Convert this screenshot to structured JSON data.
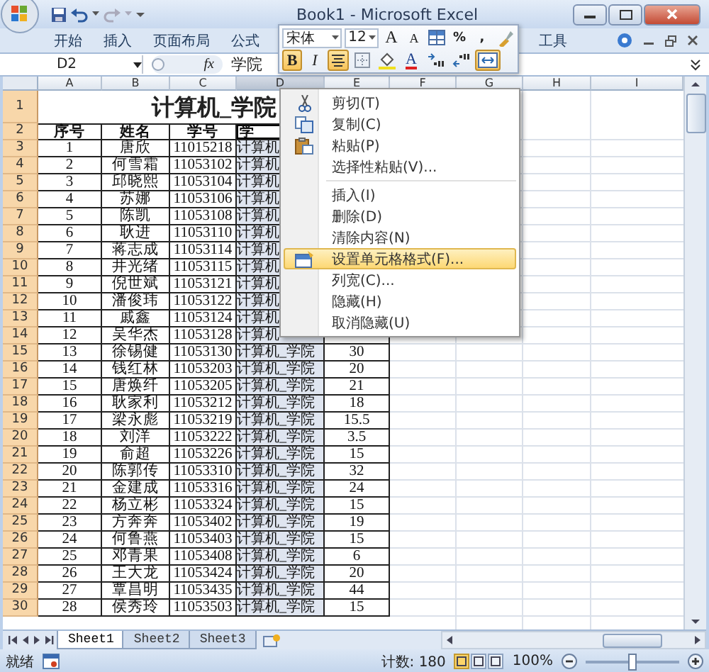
{
  "window": {
    "title": "Book1 - Microsoft Excel"
  },
  "ribbon_tabs": [
    {
      "label": "开始"
    },
    {
      "label": "插入"
    },
    {
      "label": "页面布局"
    },
    {
      "label": "公式"
    },
    {
      "label": "工具"
    }
  ],
  "formula_bar": {
    "name_box": "D2",
    "function_label": "fx",
    "value": "学院"
  },
  "mini_toolbar": {
    "font": "宋体",
    "size": "12",
    "buttons": [
      {
        "kind": "grow-font",
        "label": "A",
        "on": false
      },
      {
        "kind": "shrink-font",
        "label": "A",
        "on": false
      },
      {
        "kind": "styles",
        "on": false
      },
      {
        "kind": "text",
        "label": "%",
        "on": false
      },
      {
        "kind": "text",
        "label": ",",
        "on": false
      },
      {
        "kind": "painter",
        "on": false
      }
    ],
    "format_buttons": [
      {
        "kind": "bold",
        "label": "B",
        "on": true
      },
      {
        "kind": "italic",
        "label": "I",
        "on": false
      },
      {
        "kind": "center",
        "on": true
      },
      {
        "kind": "borders",
        "on": false
      },
      {
        "kind": "fill",
        "on": false
      },
      {
        "kind": "font-color",
        "label": "A",
        "on": false
      },
      {
        "kind": "inc-decimal",
        "on": false
      },
      {
        "kind": "dec-decimal",
        "on": false
      },
      {
        "kind": "merge",
        "on": true
      }
    ]
  },
  "columns": [
    {
      "label": "A",
      "selected": false
    },
    {
      "label": "B",
      "selected": false
    },
    {
      "label": "C",
      "selected": false
    },
    {
      "label": "D",
      "selected": true
    },
    {
      "label": "E",
      "selected": false
    },
    {
      "label": "F",
      "selected": false
    },
    {
      "label": "G",
      "selected": false
    },
    {
      "label": "H",
      "selected": false
    },
    {
      "label": "I",
      "selected": false
    }
  ],
  "title_row": {
    "number": "1",
    "text": "计算机_学院"
  },
  "header_row": {
    "number": "2",
    "cells": [
      "序号",
      "姓名",
      "学号",
      "学"
    ]
  },
  "rows": [
    {
      "number": "3",
      "cells": [
        "1",
        "唐欣",
        "11015218",
        "计算机"
      ]
    },
    {
      "number": "4",
      "cells": [
        "2",
        "何雪霜",
        "11053102",
        "计算机"
      ]
    },
    {
      "number": "5",
      "cells": [
        "3",
        "邱晓熙",
        "11053104",
        "计算机"
      ]
    },
    {
      "number": "6",
      "cells": [
        "4",
        "苏娜",
        "11053106",
        "计算机"
      ]
    },
    {
      "number": "7",
      "cells": [
        "5",
        "陈凯",
        "11053108",
        "计算机"
      ]
    },
    {
      "number": "8",
      "cells": [
        "6",
        "耿进",
        "11053110",
        "计算机"
      ]
    },
    {
      "number": "9",
      "cells": [
        "7",
        "蒋志成",
        "11053114",
        "计算机"
      ]
    },
    {
      "number": "10",
      "cells": [
        "8",
        "井光绪",
        "11053115",
        "计算机"
      ]
    },
    {
      "number": "11",
      "cells": [
        "9",
        "倪世斌",
        "11053121",
        "计算机"
      ]
    },
    {
      "number": "12",
      "cells": [
        "10",
        "潘俊玮",
        "11053122",
        "计算机"
      ]
    },
    {
      "number": "13",
      "cells": [
        "11",
        "戚鑫",
        "11053124",
        "计算机"
      ]
    },
    {
      "number": "14",
      "cells": [
        "12",
        "吴华杰",
        "11053128",
        "计算机"
      ]
    },
    {
      "number": "15",
      "cells": [
        "13",
        "徐锡健",
        "11053130",
        "计算机_学院",
        "30"
      ]
    },
    {
      "number": "16",
      "cells": [
        "14",
        "钱红林",
        "11053203",
        "计算机_学院",
        "20"
      ]
    },
    {
      "number": "17",
      "cells": [
        "15",
        "唐焕纤",
        "11053205",
        "计算机_学院",
        "21"
      ]
    },
    {
      "number": "18",
      "cells": [
        "16",
        "耿家利",
        "11053212",
        "计算机_学院",
        "18"
      ]
    },
    {
      "number": "19",
      "cells": [
        "17",
        "梁永彪",
        "11053219",
        "计算机_学院",
        "15.5"
      ]
    },
    {
      "number": "20",
      "cells": [
        "18",
        "刘洋",
        "11053222",
        "计算机_学院",
        "3.5"
      ]
    },
    {
      "number": "21",
      "cells": [
        "19",
        "俞超",
        "11053226",
        "计算机_学院",
        "15"
      ]
    },
    {
      "number": "22",
      "cells": [
        "20",
        "陈郭传",
        "11053310",
        "计算机_学院",
        "32"
      ]
    },
    {
      "number": "23",
      "cells": [
        "21",
        "金建成",
        "11053316",
        "计算机_学院",
        "24"
      ]
    },
    {
      "number": "24",
      "cells": [
        "22",
        "杨立彬",
        "11053324",
        "计算机_学院",
        "15"
      ]
    },
    {
      "number": "25",
      "cells": [
        "23",
        "方奔奔",
        "11053402",
        "计算机_学院",
        "19"
      ]
    },
    {
      "number": "26",
      "cells": [
        "24",
        "何鲁燕",
        "11053403",
        "计算机_学院",
        "15"
      ]
    },
    {
      "number": "27",
      "cells": [
        "25",
        "邓青果",
        "11053408",
        "计算机_学院",
        "6"
      ]
    },
    {
      "number": "28",
      "cells": [
        "26",
        "王大龙",
        "11053424",
        "计算机_学院",
        "20"
      ]
    },
    {
      "number": "29",
      "cells": [
        "27",
        "覃昌明",
        "11053435",
        "计算机_学院",
        "44"
      ]
    },
    {
      "number": "30",
      "cells": [
        "28",
        "侯秀玲",
        "11053503",
        "计算机_学院",
        "15"
      ]
    }
  ],
  "context_menu": [
    {
      "kind": "cut",
      "label": "剪切(T)",
      "selected": false
    },
    {
      "kind": "copy",
      "label": "复制(C)",
      "selected": false
    },
    {
      "kind": "paste",
      "label": "粘贴(P)",
      "selected": false
    },
    {
      "kind": "plain",
      "label": "选择性粘贴(V)...",
      "selected": false
    },
    {
      "kind": "separator"
    },
    {
      "kind": "plain",
      "label": "插入(I)",
      "selected": false
    },
    {
      "kind": "plain",
      "label": "删除(D)",
      "selected": false
    },
    {
      "kind": "plain",
      "label": "清除内容(N)",
      "selected": false
    },
    {
      "kind": "format",
      "label": "设置单元格格式(F)...",
      "selected": true
    },
    {
      "kind": "plain",
      "label": "列宽(C)...",
      "selected": false
    },
    {
      "kind": "plain",
      "label": "隐藏(H)",
      "selected": false
    },
    {
      "kind": "plain",
      "label": "取消隐藏(U)",
      "selected": false
    }
  ],
  "sheet_tabs": [
    {
      "label": "Sheet1",
      "selected": true
    },
    {
      "label": "Sheet2",
      "selected": false
    },
    {
      "label": "Sheet3",
      "selected": false
    }
  ],
  "status_bar": {
    "status": "就绪",
    "count": "计数: 180",
    "view_buttons": [
      {
        "selected": true
      },
      {
        "selected": false
      },
      {
        "selected": false
      }
    ],
    "zoom": "100%",
    "zoom_slider": {
      "level": 0.5
    }
  }
}
